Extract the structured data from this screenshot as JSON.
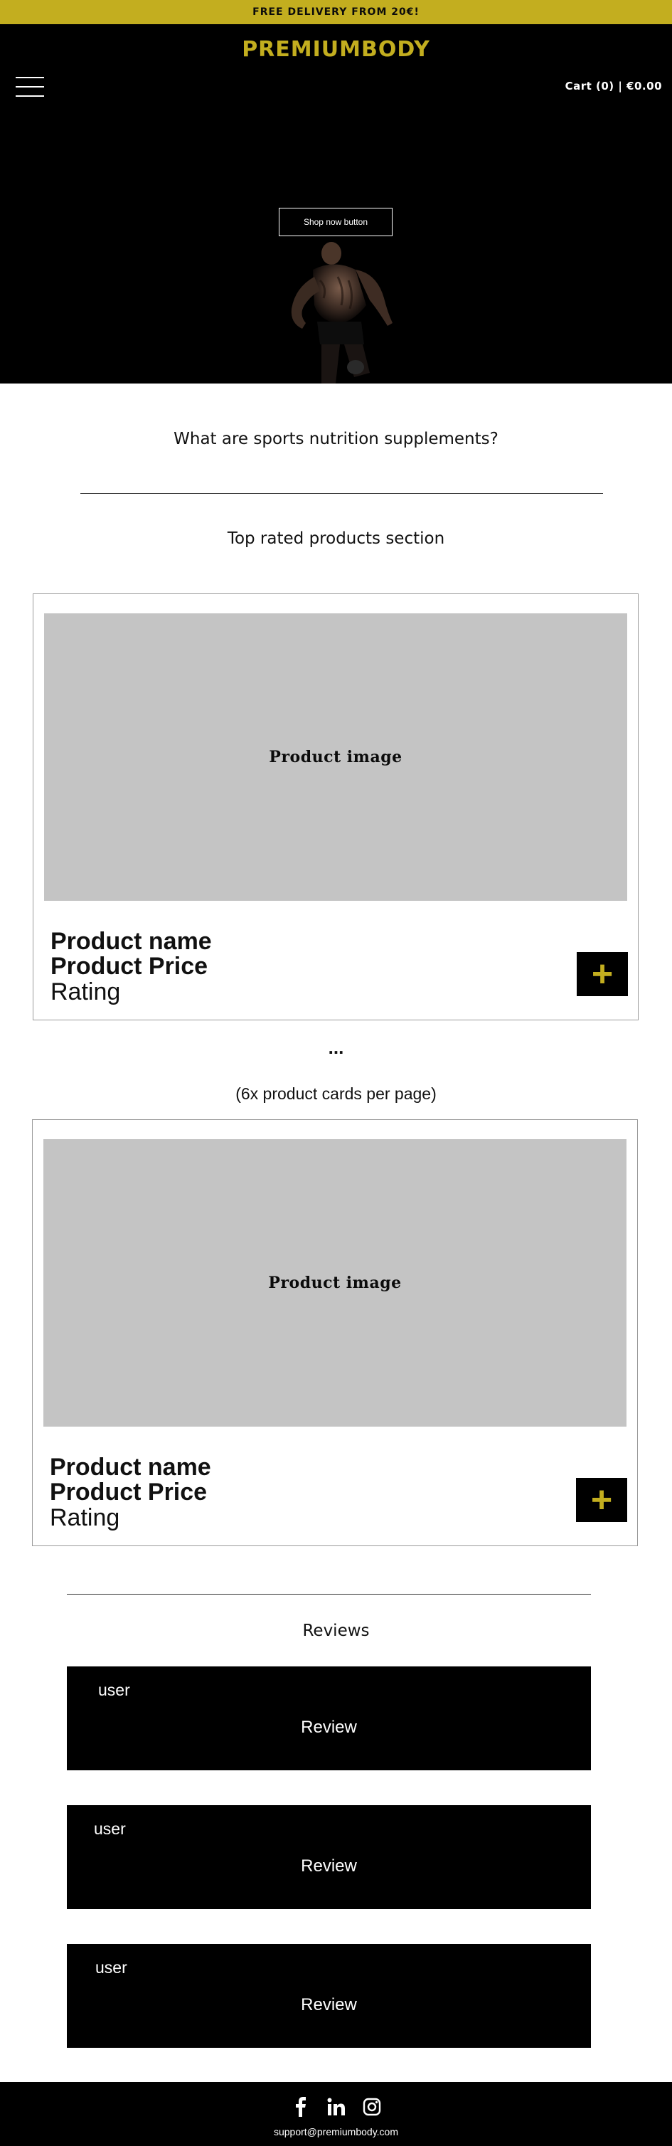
{
  "topbar": {
    "text": "FREE DELIVERY FROM 20€!"
  },
  "header": {
    "logo": "PREMIUMBODY",
    "cart": "Cart (0) | €0.00",
    "menu_icon": "hamburger-menu-icon"
  },
  "hero": {
    "button": "Shop now button"
  },
  "sections": {
    "intro_title": "What are  sports nutrition supplements?",
    "top_rated_title": "Top rated products section",
    "ellipsis": "...",
    "per_page_note": "(6x product cards per page)",
    "reviews_title": "Reviews"
  },
  "products": [
    {
      "image": "Product image",
      "name": "Product name",
      "price": "Product Price",
      "rating": "Rating",
      "add_icon": "+"
    },
    {
      "image": "Product image",
      "name": "Product name",
      "price": "Product Price",
      "rating": "Rating",
      "add_icon": "+"
    }
  ],
  "reviews": [
    {
      "user": "user",
      "text": "Review"
    },
    {
      "user": "user",
      "text": "Review"
    },
    {
      "user": "user",
      "text": "Review"
    }
  ],
  "footer": {
    "social": [
      "facebook-icon",
      "linkedin-icon",
      "instagram-icon"
    ],
    "email": "support@premiumbody.com"
  },
  "colors": {
    "accent": "#c3ae1f",
    "dark": "#000000",
    "placeholder": "#c4c4c4"
  }
}
